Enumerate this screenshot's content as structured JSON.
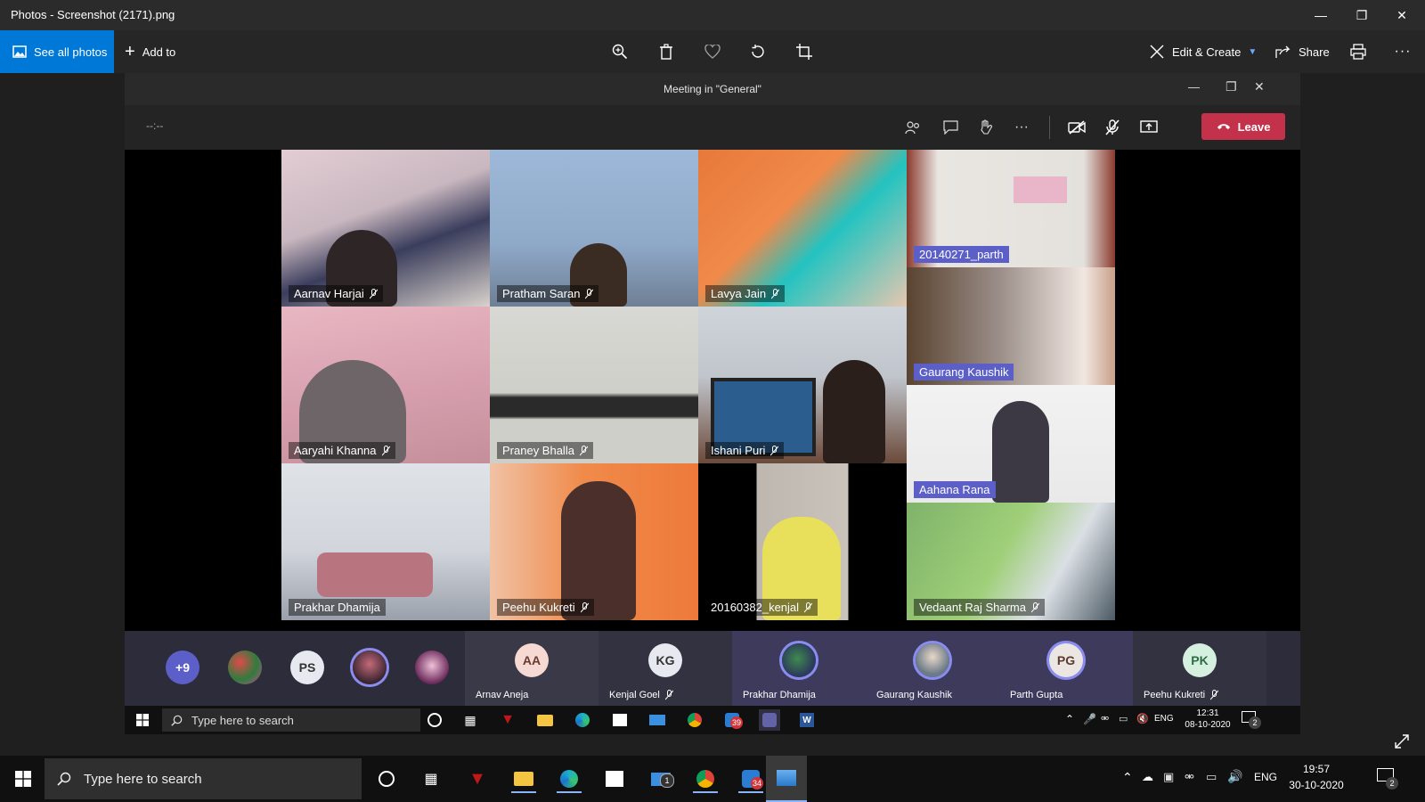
{
  "window": {
    "title": "Photos - Screenshot (2171).png",
    "see_all_label": "See all photos",
    "add_to_label": "Add to",
    "edit_create_label": "Edit & Create",
    "share_label": "Share"
  },
  "meeting": {
    "title": "Meeting in \"General\"",
    "timer": "--:--",
    "leave_label": "Leave",
    "tiles": [
      {
        "name": "Aarnav Harjai",
        "muted": true
      },
      {
        "name": "Pratham Saran",
        "muted": true
      },
      {
        "name": "Lavya Jain",
        "muted": true
      },
      {
        "name": "20140271_parth",
        "muted": false
      },
      {
        "name": "Gaurang Kaushik",
        "muted": false
      },
      {
        "name": "Aaryahi Khanna",
        "muted": true
      },
      {
        "name": "Praney Bhalla",
        "muted": true
      },
      {
        "name": "Ishani Puri",
        "muted": true
      },
      {
        "name": "Aahana Rana",
        "muted": false
      },
      {
        "name": "Prakhar Dhamija",
        "muted": false
      },
      {
        "name": "Peehu Kukreti",
        "muted": true
      },
      {
        "name": "20160382_kenjal",
        "muted": true
      },
      {
        "name": "Vedaant Raj Sharma",
        "muted": true
      }
    ],
    "strip": {
      "more_count": "+9",
      "initials_ps": "PS",
      "participants": [
        {
          "initials": "AA",
          "name": "Arnav Aneja"
        },
        {
          "initials": "KG",
          "name": "Kenjal Goel"
        },
        {
          "initials": "",
          "name": "Prakhar Dhamija"
        },
        {
          "initials": "",
          "name": "Gaurang Kaushik"
        },
        {
          "initials": "PG",
          "name": "Parth Gupta"
        },
        {
          "initials": "PK",
          "name": "Peehu Kukreti"
        }
      ]
    }
  },
  "inner_taskbar": {
    "search_placeholder": "Type here to search",
    "lang": "ENG",
    "time": "12:31",
    "date": "08-10-2020",
    "mail_badge": "39",
    "notif_count": "2"
  },
  "outer_taskbar": {
    "search_placeholder": "Type here to search",
    "lang": "ENG",
    "time": "19:57",
    "date": "30-10-2020",
    "mail_badge": "1",
    "chat_badge": "34",
    "notif_count": "2"
  },
  "colors": {
    "accent": "#0078d7",
    "teams_purple": "#5b5fc7",
    "leave_red": "#c4314b"
  }
}
